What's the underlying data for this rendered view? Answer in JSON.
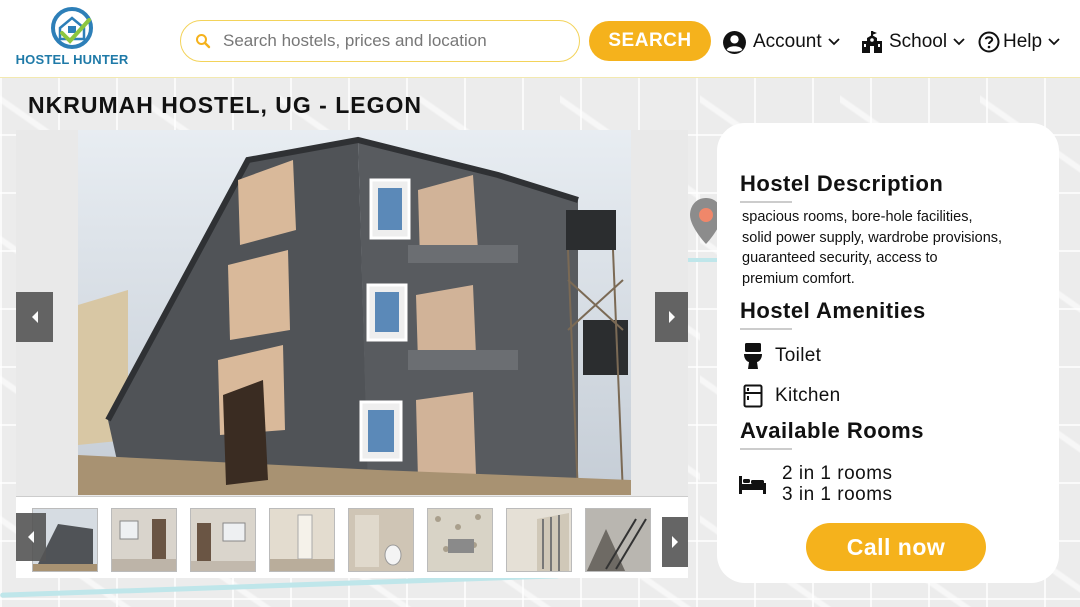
{
  "logo": {
    "text": "HOSTEL HUNTER"
  },
  "search": {
    "placeholder": "Search hostels, prices and location",
    "button_label": "SEARCH"
  },
  "nav": [
    {
      "label": "Account",
      "icon": "account-circle-icon"
    },
    {
      "label": "School",
      "icon": "school-building-icon"
    },
    {
      "label": "Help",
      "icon": "help-circle-icon"
    }
  ],
  "hostel": {
    "title": "NKRUMAH HOSTEL, UG - LEGON"
  },
  "gallery": {
    "thumbnails": 8
  },
  "info": {
    "description_title": "Hostel Description",
    "description": "spacious rooms, bore-hole facilities,\n solid power supply, wardrobe provisions,\n guaranteed security, access to\npremium comfort.",
    "amenities_title": "Hostel Amenities",
    "amenities": [
      {
        "label": "Toilet",
        "icon": "toilet-icon"
      },
      {
        "label": "Kitchen",
        "icon": "fridge-icon"
      }
    ],
    "rooms_title": "Available Rooms",
    "rooms": [
      "2 in 1 rooms",
      "3 in 1 rooms"
    ],
    "call_label": "Call now"
  },
  "colors": {
    "accent": "#f5b21c",
    "brand": "#1f7aa8"
  }
}
